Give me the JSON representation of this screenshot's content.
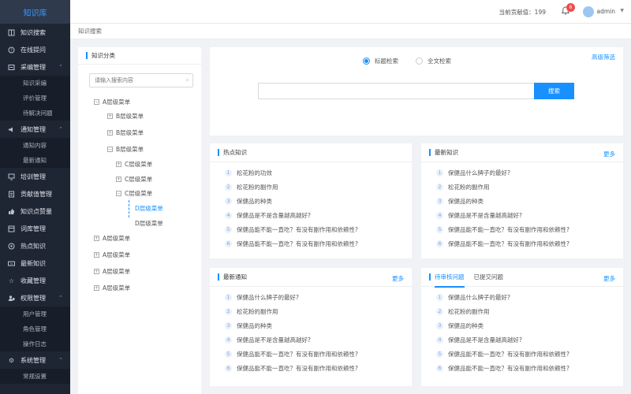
{
  "app": {
    "title": "知识库"
  },
  "sidebar": {
    "items": [
      {
        "label": "知识搜索",
        "icon": "book-icon"
      },
      {
        "label": "在线提问",
        "icon": "question-icon"
      },
      {
        "label": "采编管理",
        "icon": "edit-icon",
        "children": [
          "知识采编",
          "评价管理",
          "待解决问题"
        ]
      },
      {
        "label": "通知管理",
        "icon": "speaker-icon",
        "children": [
          "通知内容",
          "最新通知"
        ]
      },
      {
        "label": "培训管理",
        "icon": "training-icon"
      },
      {
        "label": "贡献值管理",
        "icon": "contribution-icon"
      },
      {
        "label": "知识点赞量",
        "icon": "thumbs-up-icon"
      },
      {
        "label": "词库管理",
        "icon": "dictionary-icon"
      },
      {
        "label": "热点知识",
        "icon": "hot-icon"
      },
      {
        "label": "最新知识",
        "icon": "new-icon"
      },
      {
        "label": "收藏管理",
        "icon": "star-icon"
      },
      {
        "label": "权限管理",
        "icon": "permission-icon",
        "children": [
          "用户管理",
          "角色管理",
          "操作日志"
        ]
      },
      {
        "label": "系统管理",
        "icon": "gear-icon",
        "children": [
          "常规设置"
        ]
      }
    ]
  },
  "header": {
    "contribution_label": "当前贡献值：",
    "contribution_value": "199",
    "notification_count": "6",
    "username": "admin"
  },
  "breadcrumb": "知识搜索",
  "category": {
    "title": "知识分类",
    "search_placeholder": "请输入搜索内容",
    "tree": [
      {
        "label": "A层级菜单",
        "level": 0,
        "sign": "−"
      },
      {
        "label": "B层级菜单",
        "level": 1,
        "sign": "+"
      },
      {
        "label": "B层级菜单",
        "level": 1,
        "sign": "+"
      },
      {
        "label": "B层级菜单",
        "level": 1,
        "sign": "−"
      },
      {
        "label": "C层级菜单",
        "level": 2,
        "sign": "+"
      },
      {
        "label": "C层级菜单",
        "level": 2,
        "sign": "+"
      },
      {
        "label": "C层级菜单",
        "level": 2,
        "sign": "−"
      },
      {
        "label": "D层级菜单",
        "level": 3,
        "active": true
      },
      {
        "label": "D层级菜单",
        "level": 3
      },
      {
        "label": "A层级菜单",
        "level": 0,
        "sign": "+"
      },
      {
        "label": "A层级菜单",
        "level": 0,
        "sign": "+"
      },
      {
        "label": "A层级菜单",
        "level": 0,
        "sign": "+"
      },
      {
        "label": "A层级菜单",
        "level": 0,
        "sign": "+"
      }
    ]
  },
  "search": {
    "mode_title": "标题检索",
    "mode_fulltext": "全文检索",
    "advanced": "高级筛选",
    "input_value": "",
    "button": "搜索"
  },
  "cards": {
    "hot": {
      "title": "热点知识",
      "items": [
        "松花粉的功效",
        "松花粉的副作用",
        "保健品的种类",
        "保健品是不是含量越高越好?",
        "保健品能不能一直吃？有没有副作用和依赖性?",
        "保健品能不能一直吃？有没有副作用和依赖性?"
      ]
    },
    "latest": {
      "title": "最新知识",
      "more": "更多",
      "items": [
        "保健品什么牌子的最好?",
        "松花粉的副作用",
        "保健品的种类",
        "保健品是不是含量越高越好?",
        "保健品能不能一直吃？有没有副作用和依赖性?",
        "保健品能不能一直吃？有没有副作用和依赖性?"
      ]
    },
    "notices": {
      "title": "最新通知",
      "more": "更多",
      "items": [
        "保健品什么牌子的最好?",
        "松花粉的副作用",
        "保健品的种类",
        "保健品是不是含量越高越好?",
        "保健品能不能一直吃？有没有副作用和依赖性?",
        "保健品能不能一直吃？有没有副作用和依赖性?"
      ]
    },
    "questions": {
      "tab_pending": "待审核问题",
      "tab_submitted": "已提交问题",
      "more": "更多",
      "items": [
        "保健品什么牌子的最好?",
        "松花粉的副作用",
        "保健品的种类",
        "保健品是不是含量越高越好?",
        "保健品能不能一直吃？有没有副作用和依赖性?",
        "保健品能不能一直吃？有没有副作用和依赖性?"
      ]
    }
  },
  "colors": {
    "accent": "#1890ff",
    "sidebar": "#1f2633",
    "badge": "#ef4c4c"
  }
}
